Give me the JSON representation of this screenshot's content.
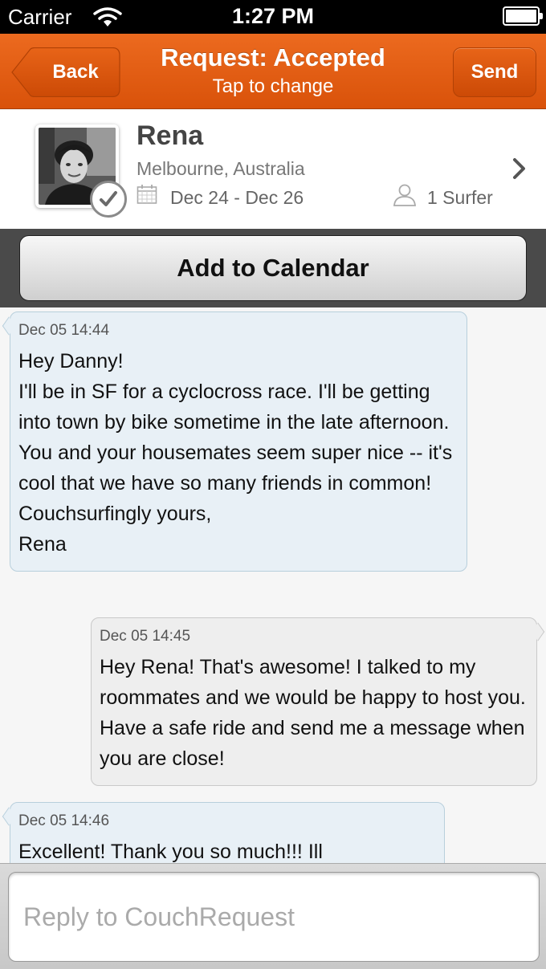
{
  "status_bar": {
    "carrier": "Carrier",
    "time": "1:27 PM"
  },
  "nav": {
    "back_label": "Back",
    "title": "Request: Accepted",
    "subtitle": "Tap to change",
    "send_label": "Send",
    "accent_color": "#e05a12"
  },
  "profile": {
    "name": "Rena",
    "location": "Melbourne, Australia",
    "dates": "Dec 24 - Dec 26",
    "surfers": "1 Surfer"
  },
  "calendar_button": {
    "label": "Add to Calendar"
  },
  "messages": [
    {
      "direction": "in",
      "time": "Dec 05 14:44",
      "text": "Hey Danny!\nI'll be in SF for a cyclocross race. I'll be getting into town by bike sometime in the late afternoon. You and your housemates seem super nice -- it's cool that we have so many friends in common!\nCouchsurfingly yours,\nRena"
    },
    {
      "direction": "out",
      "time": "Dec 05 14:45",
      "text": "Hey Rena! That's awesome! I talked to my roommates and we would be happy to host you. Have a safe ride and send me a message when you are close!"
    },
    {
      "direction": "in",
      "time": "Dec 05 14:46",
      "text": "Excellent! Thank you so much!!! Ill"
    }
  ],
  "reply": {
    "placeholder": "Reply to CouchRequest",
    "value": ""
  }
}
